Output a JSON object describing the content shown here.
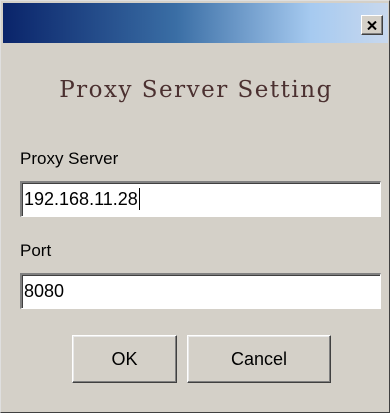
{
  "window": {
    "close_icon": "close-x-icon"
  },
  "dialog": {
    "title": "Proxy Server Setting"
  },
  "proxy_server": {
    "label": "Proxy Server",
    "value": "192.168.11.28"
  },
  "port": {
    "label": "Port",
    "value": "8080"
  },
  "buttons": {
    "ok_label": "OK",
    "cancel_label": "Cancel"
  },
  "colors": {
    "face": "#d4d0c8",
    "titlebar_start": "#0a246a",
    "titlebar_end": "#c8d8ee",
    "title_text": "#4b3030"
  }
}
